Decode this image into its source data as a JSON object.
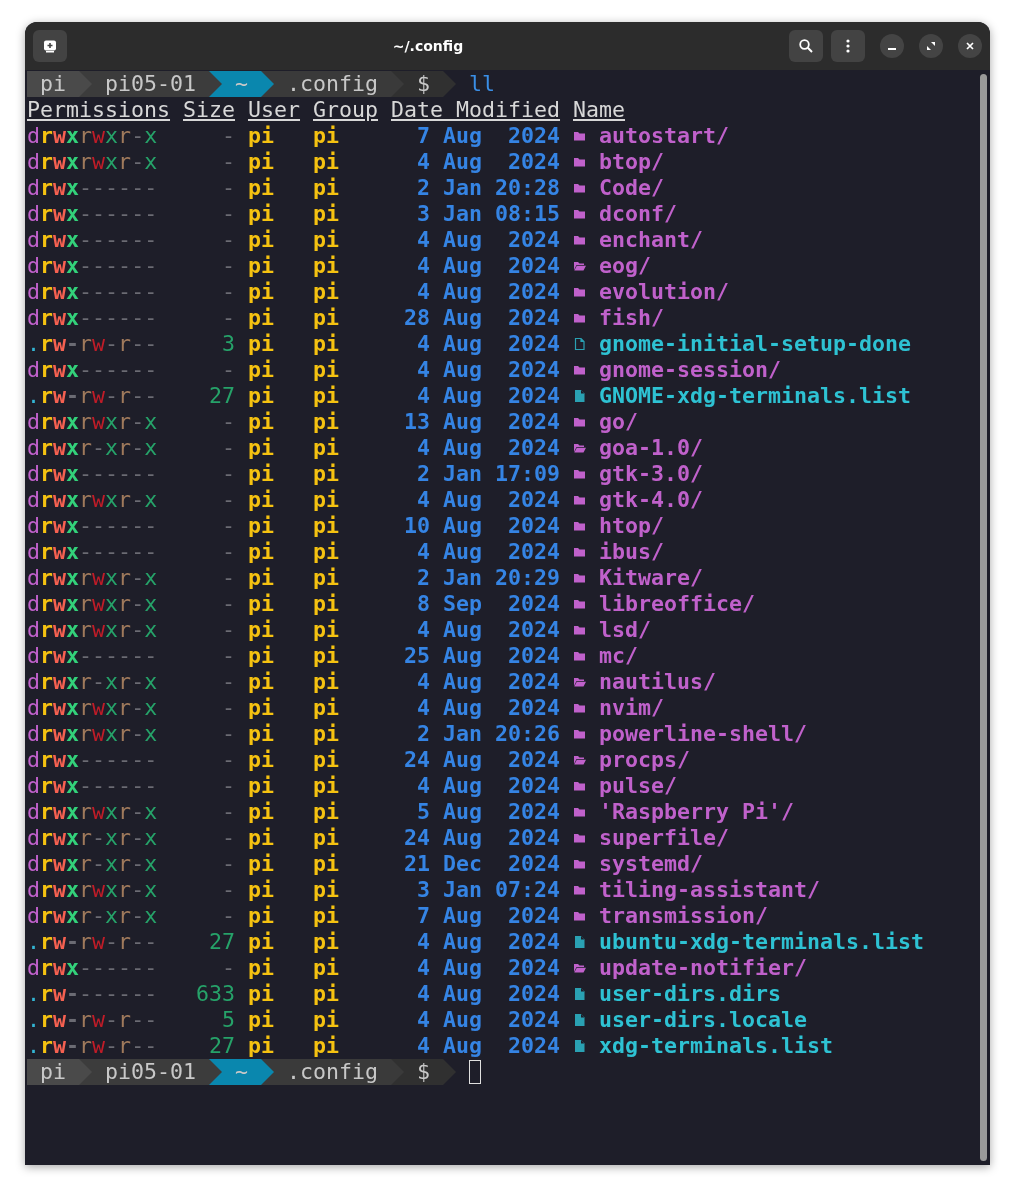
{
  "window": {
    "title": "~/.config"
  },
  "prompt": {
    "segments": [
      {
        "text": "pi",
        "color": "#4a4a4a"
      },
      {
        "text": "pi05-01",
        "color": "#3c3c3c"
      },
      {
        "text": "~",
        "color": "#0a87ae"
      },
      {
        "text": ".config",
        "color": "#3a3a3a"
      },
      {
        "text": "$",
        "color": "#303030"
      }
    ],
    "command": "ll"
  },
  "listing": {
    "columns": [
      "Permissions",
      "Size",
      "User",
      "Group",
      "Date Modified",
      "Name"
    ],
    "rows": [
      {
        "permissions": "drwxrwxr-x",
        "size": "-",
        "user": "pi",
        "group": "pi",
        "date": "7 Aug  2024",
        "kind": "folder",
        "name": "autostart/"
      },
      {
        "permissions": "drwxrwxr-x",
        "size": "-",
        "user": "pi",
        "group": "pi",
        "date": "4 Aug  2024",
        "kind": "folder",
        "name": "btop/"
      },
      {
        "permissions": "drwx------",
        "size": "-",
        "user": "pi",
        "group": "pi",
        "date": "2 Jan 20:28",
        "kind": "folder",
        "name": "Code/"
      },
      {
        "permissions": "drwx------",
        "size": "-",
        "user": "pi",
        "group": "pi",
        "date": "3 Jan 08:15",
        "kind": "folder",
        "name": "dconf/"
      },
      {
        "permissions": "drwx------",
        "size": "-",
        "user": "pi",
        "group": "pi",
        "date": "4 Aug  2024",
        "kind": "folder",
        "name": "enchant/"
      },
      {
        "permissions": "drwx------",
        "size": "-",
        "user": "pi",
        "group": "pi",
        "date": "4 Aug  2024",
        "kind": "open-folder",
        "name": "eog/"
      },
      {
        "permissions": "drwx------",
        "size": "-",
        "user": "pi",
        "group": "pi",
        "date": "4 Aug  2024",
        "kind": "folder",
        "name": "evolution/"
      },
      {
        "permissions": "drwx------",
        "size": "-",
        "user": "pi",
        "group": "pi",
        "date": "28 Aug  2024",
        "kind": "folder",
        "name": "fish/"
      },
      {
        "permissions": ".rw-rw-r--",
        "size": "3",
        "user": "pi",
        "group": "pi",
        "date": "4 Aug  2024",
        "kind": "empty-file",
        "name": "gnome-initial-setup-done"
      },
      {
        "permissions": "drwx------",
        "size": "-",
        "user": "pi",
        "group": "pi",
        "date": "4 Aug  2024",
        "kind": "folder",
        "name": "gnome-session/"
      },
      {
        "permissions": ".rw-rw-r--",
        "size": "27",
        "user": "pi",
        "group": "pi",
        "date": "4 Aug  2024",
        "kind": "file",
        "name": "GNOME-xdg-terminals.list"
      },
      {
        "permissions": "drwxrwxr-x",
        "size": "-",
        "user": "pi",
        "group": "pi",
        "date": "13 Aug  2024",
        "kind": "folder",
        "name": "go/"
      },
      {
        "permissions": "drwxr-xr-x",
        "size": "-",
        "user": "pi",
        "group": "pi",
        "date": "4 Aug  2024",
        "kind": "open-folder",
        "name": "goa-1.0/"
      },
      {
        "permissions": "drwx------",
        "size": "-",
        "user": "pi",
        "group": "pi",
        "date": "2 Jan 17:09",
        "kind": "folder",
        "name": "gtk-3.0/"
      },
      {
        "permissions": "drwxrwxr-x",
        "size": "-",
        "user": "pi",
        "group": "pi",
        "date": "4 Aug  2024",
        "kind": "folder",
        "name": "gtk-4.0/"
      },
      {
        "permissions": "drwx------",
        "size": "-",
        "user": "pi",
        "group": "pi",
        "date": "10 Aug  2024",
        "kind": "folder",
        "name": "htop/"
      },
      {
        "permissions": "drwx------",
        "size": "-",
        "user": "pi",
        "group": "pi",
        "date": "4 Aug  2024",
        "kind": "folder",
        "name": "ibus/"
      },
      {
        "permissions": "drwxrwxr-x",
        "size": "-",
        "user": "pi",
        "group": "pi",
        "date": "2 Jan 20:29",
        "kind": "folder",
        "name": "Kitware/"
      },
      {
        "permissions": "drwxrwxr-x",
        "size": "-",
        "user": "pi",
        "group": "pi",
        "date": "8 Sep  2024",
        "kind": "folder",
        "name": "libreoffice/"
      },
      {
        "permissions": "drwxrwxr-x",
        "size": "-",
        "user": "pi",
        "group": "pi",
        "date": "4 Aug  2024",
        "kind": "folder",
        "name": "lsd/"
      },
      {
        "permissions": "drwx------",
        "size": "-",
        "user": "pi",
        "group": "pi",
        "date": "25 Aug  2024",
        "kind": "folder",
        "name": "mc/"
      },
      {
        "permissions": "drwxr-xr-x",
        "size": "-",
        "user": "pi",
        "group": "pi",
        "date": "4 Aug  2024",
        "kind": "open-folder",
        "name": "nautilus/"
      },
      {
        "permissions": "drwxrwxr-x",
        "size": "-",
        "user": "pi",
        "group": "pi",
        "date": "4 Aug  2024",
        "kind": "folder",
        "name": "nvim/"
      },
      {
        "permissions": "drwxrwxr-x",
        "size": "-",
        "user": "pi",
        "group": "pi",
        "date": "2 Jan 20:26",
        "kind": "folder",
        "name": "powerline-shell/"
      },
      {
        "permissions": "drwx------",
        "size": "-",
        "user": "pi",
        "group": "pi",
        "date": "24 Aug  2024",
        "kind": "open-folder",
        "name": "procps/"
      },
      {
        "permissions": "drwx------",
        "size": "-",
        "user": "pi",
        "group": "pi",
        "date": "4 Aug  2024",
        "kind": "folder",
        "name": "pulse/"
      },
      {
        "permissions": "drwxrwxr-x",
        "size": "-",
        "user": "pi",
        "group": "pi",
        "date": "5 Aug  2024",
        "kind": "folder",
        "name": "'Raspberry Pi'/"
      },
      {
        "permissions": "drwxr-xr-x",
        "size": "-",
        "user": "pi",
        "group": "pi",
        "date": "24 Aug  2024",
        "kind": "folder",
        "name": "superfile/"
      },
      {
        "permissions": "drwxr-xr-x",
        "size": "-",
        "user": "pi",
        "group": "pi",
        "date": "21 Dec  2024",
        "kind": "folder",
        "name": "systemd/"
      },
      {
        "permissions": "drwxrwxr-x",
        "size": "-",
        "user": "pi",
        "group": "pi",
        "date": "3 Jan 07:24",
        "kind": "folder",
        "name": "tiling-assistant/"
      },
      {
        "permissions": "drwxr-xr-x",
        "size": "-",
        "user": "pi",
        "group": "pi",
        "date": "7 Aug  2024",
        "kind": "folder",
        "name": "transmission/"
      },
      {
        "permissions": ".rw-rw-r--",
        "size": "27",
        "user": "pi",
        "group": "pi",
        "date": "4 Aug  2024",
        "kind": "file",
        "name": "ubuntu-xdg-terminals.list"
      },
      {
        "permissions": "drwx------",
        "size": "-",
        "user": "pi",
        "group": "pi",
        "date": "4 Aug  2024",
        "kind": "open-folder",
        "name": "update-notifier/"
      },
      {
        "permissions": ".rw-------",
        "size": "633",
        "user": "pi",
        "group": "pi",
        "date": "4 Aug  2024",
        "kind": "file",
        "name": "user-dirs.dirs"
      },
      {
        "permissions": ".rw-rw-r--",
        "size": "5",
        "user": "pi",
        "group": "pi",
        "date": "4 Aug  2024",
        "kind": "file",
        "name": "user-dirs.locale"
      },
      {
        "permissions": ".rw-rw-r--",
        "size": "27",
        "user": "pi",
        "group": "pi",
        "date": "4 Aug  2024",
        "kind": "file",
        "name": "xdg-terminals.list"
      }
    ]
  },
  "final_prompt": {
    "segments": [
      {
        "text": "pi",
        "color": "#4a4a4a"
      },
      {
        "text": "pi05-01",
        "color": "#3c3c3c"
      },
      {
        "text": "~",
        "color": "#0a87ae"
      },
      {
        "text": ".config",
        "color": "#3a3a3a"
      },
      {
        "text": "$",
        "color": "#303030"
      }
    ],
    "cursor": true
  }
}
